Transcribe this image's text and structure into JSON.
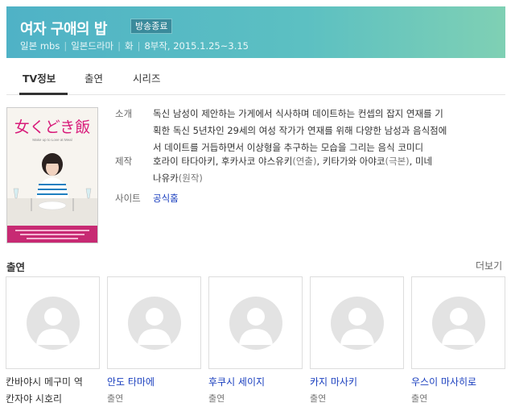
{
  "header": {
    "title": "여자 구애의 밥",
    "badge": "방송종료",
    "meta": [
      "일본 mbs",
      "일본드라마",
      "화",
      "8부작, 2015.1.25~3.15"
    ]
  },
  "tabs": [
    {
      "label": "TV정보",
      "active": true
    },
    {
      "label": "출연",
      "active": false
    },
    {
      "label": "시리즈",
      "active": false
    }
  ],
  "poster": {
    "title_text": "女くどき飯",
    "caption": "Make up to Love at Meal",
    "colors": {
      "title": "#d81b7a",
      "bottom_band": "#c72a73",
      "stripes": "#1e7fc0"
    }
  },
  "info": {
    "synopsis_label": "소개",
    "synopsis": [
      "독신 남성이 제안하는 가게에서 식사하며 데이트하는 컨셉의 잡지 연재를 기",
      "획한 독신 5년차인 29세의 여성 작가가 연재를 위해 다양한 남성과 음식점에",
      "서 데이트를 거듭하면서 이상형을 추구하는 모습을 그리는 음식 코미디"
    ],
    "production_label": "제작",
    "production": {
      "name1": "호라이 타다아키, 후카사코 야스유키",
      "role1": "(연출)",
      "name2": ", 키타가와 아야코",
      "role2": "(극본)",
      "name3": ", 미네",
      "name4": "나유카",
      "role4": "(원작)"
    },
    "site_label": "사이트",
    "site_link": "공식홈"
  },
  "cast_section": {
    "title": "출연",
    "more": "더보기",
    "members": [
      {
        "name": "칸바야시 메구미 역",
        "role": "칸자야 시호리",
        "name_color": "#333333",
        "role_dark": true
      },
      {
        "name": "안도 타마에",
        "role": "출연",
        "name_color": "#1a3fbf",
        "role_dark": false
      },
      {
        "name": "후쿠시 세이지",
        "role": "출연",
        "name_color": "#1a3fbf",
        "role_dark": false
      },
      {
        "name": "카지 마사키",
        "role": "출연",
        "name_color": "#1a3fbf",
        "role_dark": false
      },
      {
        "name": "우스이 마사히로",
        "role": "출연",
        "name_color": "#1a3fbf",
        "role_dark": false
      }
    ]
  }
}
